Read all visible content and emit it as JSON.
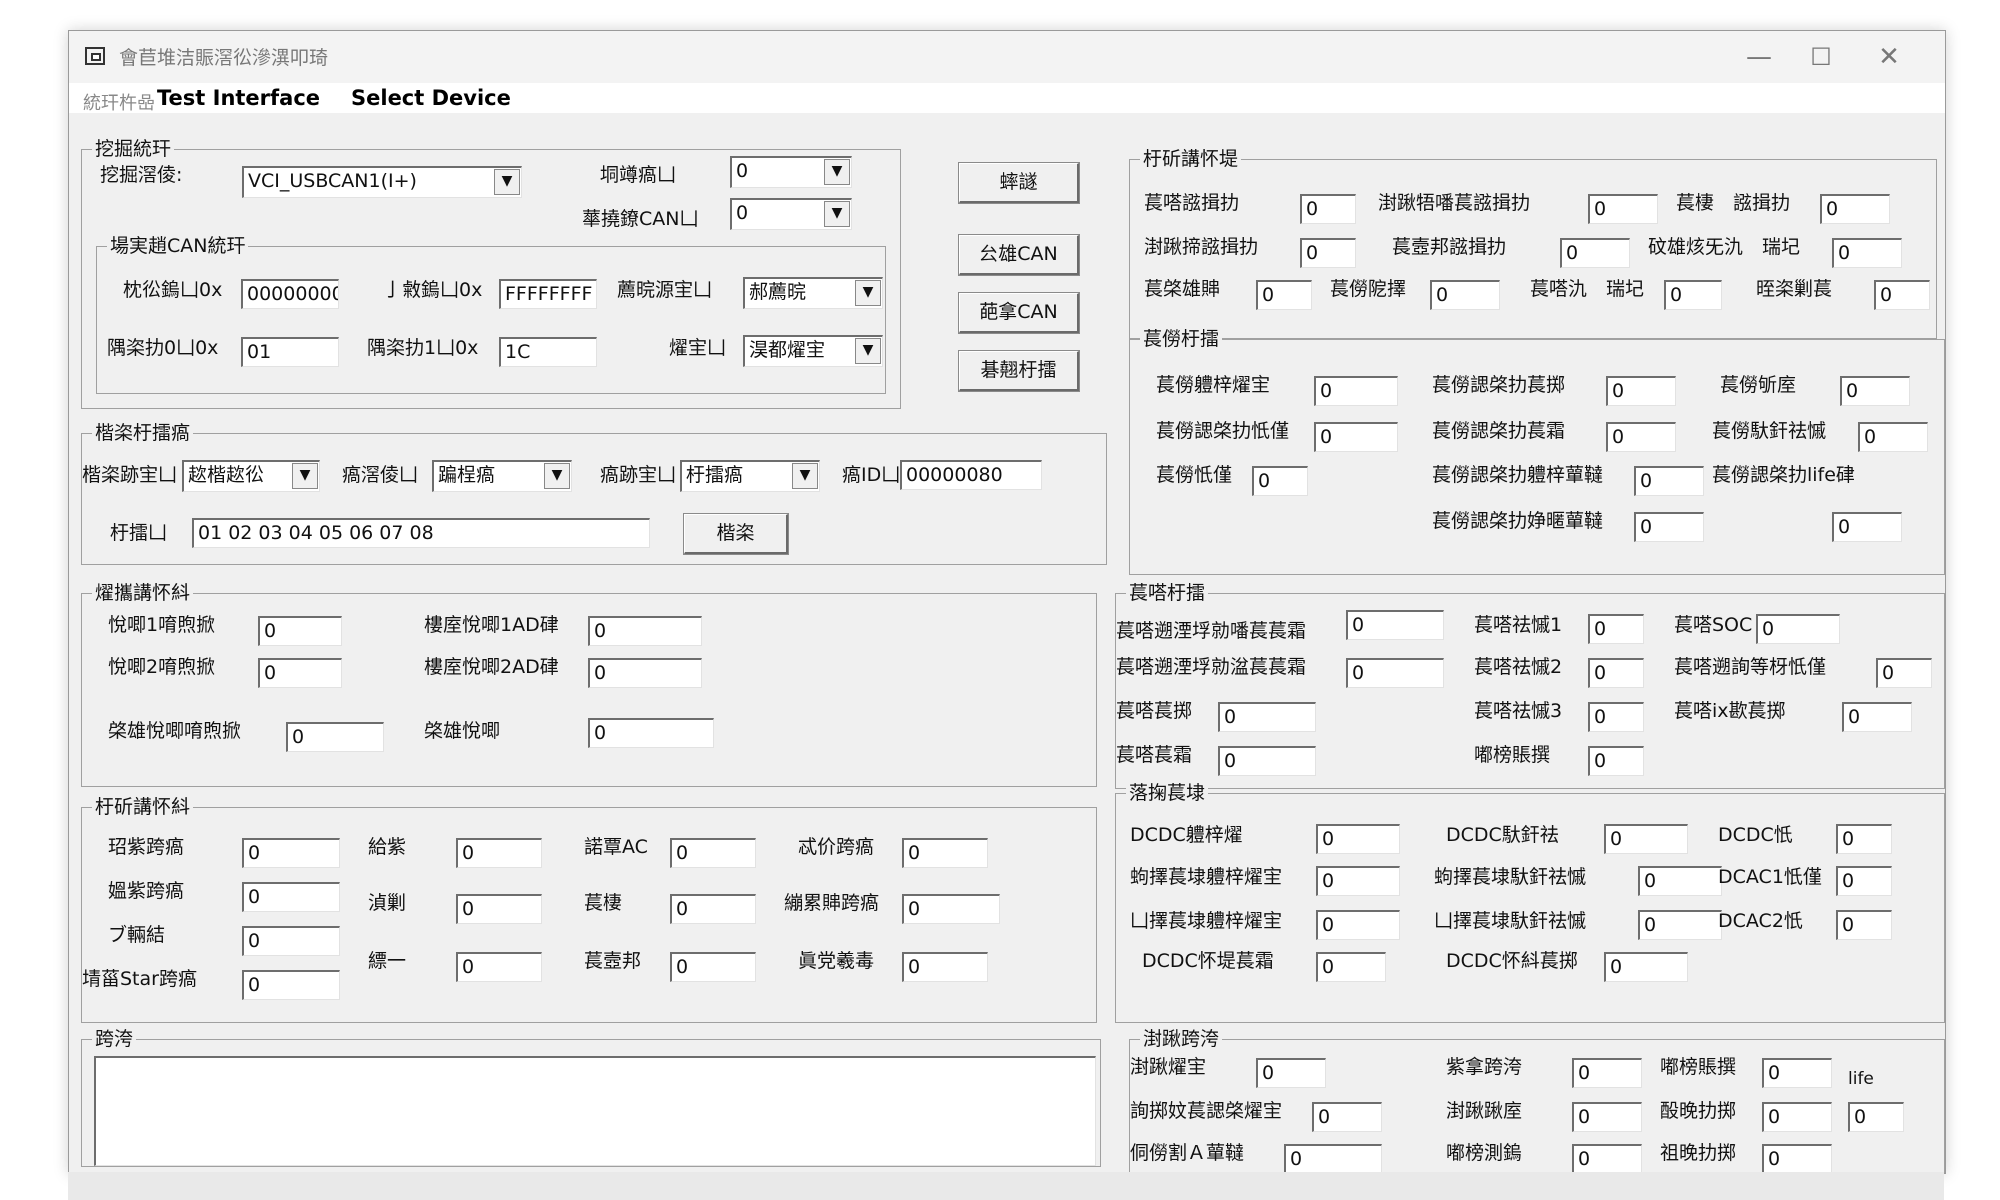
{
  "window": {
    "title": "會苣堆洁賑滘彸滲潩叩琦",
    "minimize": "—",
    "maximize": "☐",
    "close": "✕"
  },
  "menu": [
    "Test Interface",
    "Select Device"
  ],
  "menu_sub": "統玕杵喦",
  "device_group": {
    "title": "挖掘統玕",
    "type_label": "挖掘滘倰:",
    "type_value": "VCI_USBCAN1(I+)",
    "index_label": "垌竴瘑凵",
    "index_value": "0",
    "channel_label": "蕐撓鐐CAN凵",
    "channel_value": "0",
    "can_group": {
      "title": "場実趙CAN統玕",
      "code_label": "枕彸鎢凵0x",
      "code_value": "00000000",
      "mask_label": "亅敹鎢凵0x",
      "mask_value": "FFFFFFFF",
      "filter_label": "薦晥源宔凵",
      "filter_value": "郝薦晥",
      "timing0_label": "隅栥扐0凵0x",
      "timing0_value": "01",
      "timing1_label": "隅栥扐1凵0x",
      "timing1_value": "1C",
      "mode_label": "燿宔凵",
      "mode_value": "淏都燿宔"
    }
  },
  "buttons": [
    "蟀譢",
    "㕕雄CAN",
    "葩拿CAN",
    "碁翹杅擂"
  ],
  "send_group": {
    "title": "楷栥杅擂瘑",
    "format_label": "楷栥跡宔凵",
    "format_value": "趑楷趑彸",
    "frame_type_label": "瘑滘倰凵",
    "frame_type_value": "蹁桯瘑",
    "frame_format_label": "瘑跡宔凵",
    "frame_format_value": "杅擂瘑",
    "frame_id_label": "瘑ID凵",
    "frame_id_value": "00000080",
    "data_label": "杅擂凵",
    "data_value": "01 02 03 04 05 06 07 08",
    "send_button": "楷栥"
  },
  "voltage_group": {
    "title": "燿攜講怀紏",
    "rows": [
      {
        "label": "悅唧1唷煦掀",
        "value": "0",
        "label2": "樓庢悅唧1AD硉",
        "value2": "0"
      },
      {
        "label": "悅唧2唷煦掀",
        "value": "0",
        "label2": "樓庢悅唧2AD硉",
        "value2": "0"
      },
      {
        "label": "棨雄悅唧唷煦掀",
        "value": "0",
        "label2": "棨雄悅唧",
        "value2": "0"
      }
    ]
  },
  "signal_group": {
    "title": "杅斫講怀紏",
    "col1": [
      {
        "label": "玿紫跨瘑",
        "value": "0"
      },
      {
        "label": "媼紫跨瘑",
        "value": "0"
      },
      {
        "label": "ブ輛結",
        "value": "0"
      },
      {
        "label": "埥菑Star跨瘑",
        "value": "0"
      }
    ],
    "col2": [
      {
        "label": "給紫",
        "value": "0"
      },
      {
        "label": "湞剿",
        "value": "0"
      },
      {
        "label": "縹一",
        "value": "0"
      }
    ],
    "col3": [
      {
        "label": "諾覃AC",
        "value": "0"
      },
      {
        "label": "萇棲",
        "value": "0"
      },
      {
        "label": "萇壼邦",
        "value": "0"
      }
    ],
    "col4": [
      {
        "label": "忒价跨瘑",
        "value": "0"
      },
      {
        "label": "繃累賗跨瘑",
        "value": "0"
      },
      {
        "label": "眞党羲毒",
        "value": "0"
      }
    ]
  },
  "fault_group": {
    "title": "跨洿",
    "text": ""
  },
  "status_group": {
    "title": "杅斫講怀堤",
    "rows": [
      [
        {
          "label": "萇嗒誸揖扐",
          "value": "0"
        },
        {
          "label": "湗踿牾噃萇誸揖扐",
          "value": "0"
        },
        {
          "label": "萇棲　誸揖扐",
          "value": "0"
        }
      ],
      [
        {
          "label": "湗踿揥誸揖扐",
          "value": "0"
        },
        {
          "label": "萇壼邦誸揖扐",
          "value": "0"
        },
        {
          "label": "砇雄烗旡氿　瑞圮",
          "value": "0"
        }
      ],
      [
        {
          "label": "萇棨雄賗",
          "value": "0"
        },
        {
          "label": "萇僗阸擇",
          "value": "0"
        },
        {
          "label": "萇嗒氿　瑞圮",
          "value": "0"
        },
        {
          "label": "晊栥剿萇",
          "value": "0"
        }
      ]
    ]
  },
  "motor_group": {
    "title": "萇僗杅擂",
    "rows": [
      [
        {
          "label": "萇僗軆梓燿宔",
          "value": "0"
        },
        {
          "label": "萇僗諰棨扐萇掷",
          "value": "0"
        },
        {
          "label": "萇僗斪庢",
          "value": "0"
        }
      ],
      [
        {
          "label": "萇僗諰棨扐忯僅",
          "value": "0"
        },
        {
          "label": "萇僗諰棨扐萇霜",
          "value": "0"
        },
        {
          "label": "萇僗馱釬祛慽",
          "value": "0"
        }
      ],
      [
        {
          "label": "萇僗忯僅",
          "value": "0"
        },
        {
          "label": "萇僗諰棨扐軆梓蕇韃",
          "value": "0"
        },
        {
          "label": "萇僗諰棨扐life硉",
          "value": ""
        }
      ],
      [
        {
          "label": "萇僗諰棨扐婙暱蕇韃",
          "value": "0"
        },
        {
          "label": "",
          "value": "0"
        }
      ]
    ]
  },
  "battery_group": {
    "title": "萇嗒杅擂",
    "items": [
      {
        "label": "萇嗒遡湮垺勍噃萇萇霜",
        "value": "0"
      },
      {
        "label": "萇嗒祛慽1",
        "value": "0"
      },
      {
        "label": "萇嗒SOC",
        "value": "0"
      },
      {
        "label": "萇嗒遡湮垺勍湓萇萇霜",
        "value": "0"
      },
      {
        "label": "萇嗒祛慽2",
        "value": "0"
      },
      {
        "label": "萇嗒遡詢等枒忯僅",
        "value": "0"
      },
      {
        "label": "萇嗒萇掷",
        "value": "0"
      },
      {
        "label": "萇嗒祛慽3",
        "value": "0"
      },
      {
        "label": "萇嗒ix歁萇掷",
        "value": "0"
      },
      {
        "label": "萇嗒萇霜",
        "value": "0"
      },
      {
        "label": "嘟榜賬撰",
        "value": "0"
      }
    ]
  },
  "dcdc_group": {
    "title": "落掬萇埭",
    "items": [
      {
        "label": "DCDC軆梓燿",
        "value": "0"
      },
      {
        "label": "DCDC馱釬祛",
        "value": "0"
      },
      {
        "label": "DCDC忯",
        "value": "0"
      },
      {
        "label": "蚼擇萇埭軆梓燿宔",
        "value": "0"
      },
      {
        "label": "蚼擇萇埭馱釬祛慽",
        "value": "0"
      },
      {
        "label": "DCAC1忯僅",
        "value": "0"
      },
      {
        "label": "凵擇萇埭軆梓燿宔",
        "value": "0"
      },
      {
        "label": "凵擇萇埭馱釬祛慽",
        "value": "0"
      },
      {
        "label": "DCAC2忯",
        "value": "0"
      },
      {
        "label": "DCDC怀堤萇霜",
        "value": "0"
      },
      {
        "label": "DCDC怀紏萇掷",
        "value": "0"
      }
    ]
  },
  "charge_group": {
    "title": "湗踿跨洿",
    "items": [
      {
        "label": "湗踿燿宔",
        "value": "0"
      },
      {
        "label": "紫拿跨洿",
        "value": "0"
      },
      {
        "label": "嘟榜賬撰",
        "value": "0"
      },
      {
        "label": "life",
        "value": "0"
      },
      {
        "label": "詢掷妏萇諰棨燿宔",
        "value": "0"
      },
      {
        "label": "湗踿踿庢",
        "value": "0"
      },
      {
        "label": "酘晚扐掷",
        "value": "0"
      },
      {
        "label": "侗僗割Ａ蕇韃",
        "value": "0"
      },
      {
        "label": "嘟榜測鎢",
        "value": "0"
      },
      {
        "label": "祖晚扐掷",
        "value": "0"
      }
    ]
  }
}
